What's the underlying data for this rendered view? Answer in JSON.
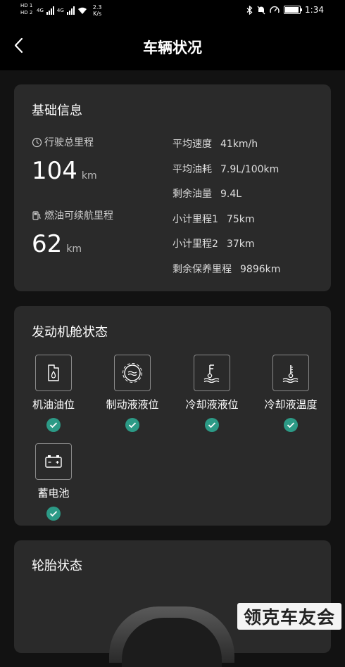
{
  "status_bar": {
    "hd1": "HD 1",
    "hd2": "HD 2",
    "net1": "4G",
    "net2": "4G",
    "speed_value": "2.3",
    "speed_unit": "K/s",
    "time": "1:34",
    "battery_level_percent": 95
  },
  "header": {
    "title": "车辆状况"
  },
  "basic_info": {
    "title": "基础信息",
    "total_mileage_label": "行驶总里程",
    "total_mileage_value": "104",
    "total_mileage_unit": "km",
    "range_label": "燃油可续航里程",
    "range_value": "62",
    "range_unit": "km",
    "stats": [
      {
        "label": "平均速度",
        "value": "41km/h"
      },
      {
        "label": "平均油耗",
        "value": "7.9L/100km"
      },
      {
        "label": "剩余油量",
        "value": "9.4L"
      },
      {
        "label": "小计里程1",
        "value": "75km"
      },
      {
        "label": "小计里程2",
        "value": "37km"
      },
      {
        "label": "剩余保养里程",
        "value": "9896km"
      }
    ]
  },
  "engine": {
    "title": "发动机舱状态",
    "items": [
      {
        "label": "机油油位",
        "icon": "oil-level-icon"
      },
      {
        "label": "制动液液位",
        "icon": "brake-fluid-icon"
      },
      {
        "label": "冷却液液位",
        "icon": "coolant-level-icon"
      },
      {
        "label": "冷却液温度",
        "icon": "coolant-temp-icon"
      },
      {
        "label": "蓄电池",
        "icon": "battery-icon"
      }
    ]
  },
  "tires": {
    "title": "轮胎状态"
  },
  "watermark": {
    "text": "领克车友会"
  },
  "colors": {
    "background": "#121212",
    "card": "#2a2a2a",
    "check": "#2c9a86"
  }
}
